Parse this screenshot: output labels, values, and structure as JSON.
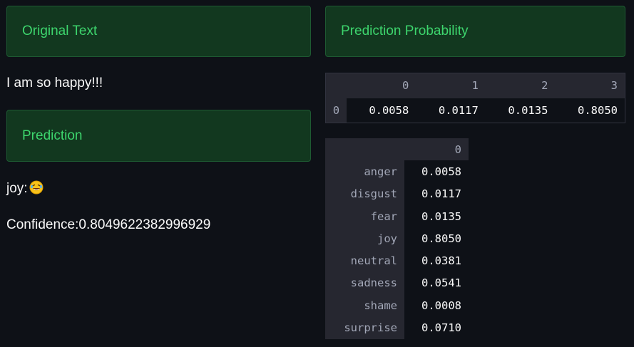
{
  "left": {
    "original_text_header": "Original Text",
    "original_text": "I am so happy!!!",
    "prediction_header": "Prediction",
    "prediction_label": "joy:",
    "prediction_emoji_icon": "laughing-face-emoji",
    "confidence_text": "Confidence:0.8049622382996929"
  },
  "right": {
    "probability_header": "Prediction Probability",
    "prob_table": {
      "columns": [
        "0",
        "1",
        "2",
        "3"
      ],
      "row_index": "0",
      "values": [
        "0.0058",
        "0.0117",
        "0.0135",
        "0.8050"
      ]
    },
    "emotion_table": {
      "column": "0",
      "rows": [
        {
          "label": "anger",
          "value": "0.0058"
        },
        {
          "label": "disgust",
          "value": "0.0117"
        },
        {
          "label": "fear",
          "value": "0.0135"
        },
        {
          "label": "joy",
          "value": "0.8050"
        },
        {
          "label": "neutral",
          "value": "0.0381"
        },
        {
          "label": "sadness",
          "value": "0.0541"
        },
        {
          "label": "shame",
          "value": "0.0008"
        },
        {
          "label": "surprise",
          "value": "0.0710"
        }
      ]
    }
  },
  "colors": {
    "background": "#0e1117",
    "success_bg": "#12381f",
    "success_text": "#3dd56d",
    "table_header_bg": "#262730"
  }
}
